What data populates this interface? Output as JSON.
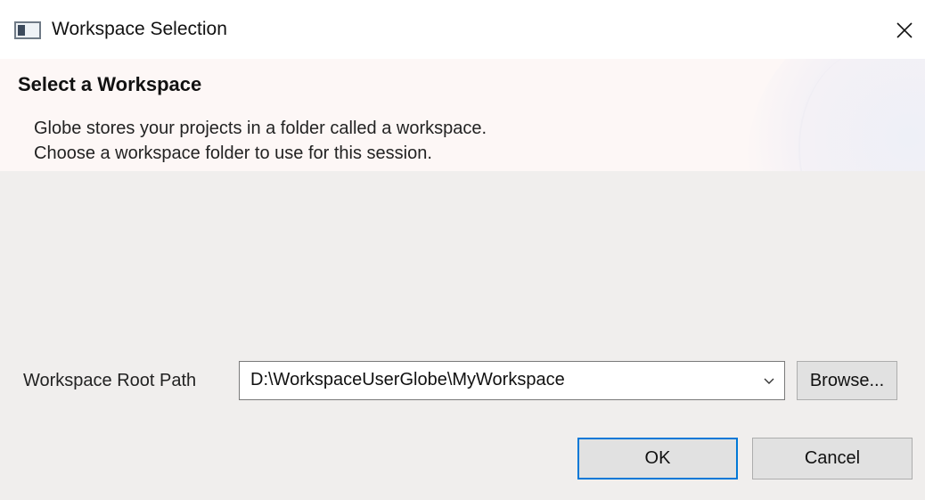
{
  "window": {
    "title": "Workspace Selection",
    "icon": "app-window-icon",
    "close_icon": "close-icon"
  },
  "banner": {
    "heading": "Select a Workspace",
    "description_line1": "Globe stores your projects in a folder called a workspace.",
    "description_line2": "Choose a workspace folder to use for this session."
  },
  "form": {
    "path_label": "Workspace Root Path",
    "path_value": "D:\\WorkspaceUserGlobe\\MyWorkspace",
    "dropdown_icon": "chevron-down-icon",
    "browse_label": "Browse..."
  },
  "buttons": {
    "ok_label": "OK",
    "cancel_label": "Cancel"
  },
  "colors": {
    "focus_border": "#0078d7",
    "button_bg": "#e1e1e1",
    "dialog_bg": "#f0eeed"
  }
}
